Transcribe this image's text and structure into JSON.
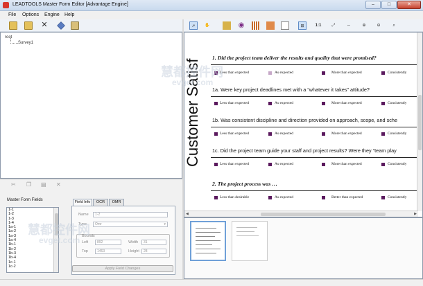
{
  "window": {
    "title": "LEADTOOLS Master Form Editor [Advantage Engine]",
    "min_glyph": "–",
    "max_glyph": "□",
    "close_glyph": "✕"
  },
  "menu": [
    "File",
    "Options",
    "Engine",
    "Help"
  ],
  "left_toolbar_icons": [
    "new-form-icon",
    "add-icon",
    "delete-icon",
    "edit-icon",
    "settings-icon"
  ],
  "tree": {
    "root": "root",
    "child": "Survey1"
  },
  "field_toolbar_icons": [
    "cut-icon",
    "copy-icon",
    "paste-icon",
    "delete-icon"
  ],
  "master_form_fields": {
    "label": "Master Form Fields",
    "items": [
      "1-1",
      "1-2",
      "1-3",
      "1-4",
      "1a-1",
      "1a-2",
      "1a-3",
      "1a-4",
      "1b-1",
      "1b-2",
      "1b-3",
      "1b-4",
      "1c-1",
      "1c-2"
    ]
  },
  "tabs": [
    "Field Info",
    "OCR",
    "OMR"
  ],
  "field_info": {
    "name_label": "Name",
    "name_value": "1-2",
    "type_label": "Type",
    "type_value": "Omr",
    "bounds_label": "Bounds",
    "left_label": "Left",
    "left_value": "892",
    "width_label": "Width",
    "width_value": "31",
    "top_label": "Top",
    "top_value": "1463",
    "height_label": "Height",
    "height_value": "28",
    "apply_label": "Apply Field Changes"
  },
  "right_toolbar_icons": [
    "select-pointer-icon",
    "pan-hand-icon",
    "text-field-icon",
    "omr-field-icon",
    "barcode-icon",
    "image-field-icon",
    "rectangle-icon",
    "region-icon",
    "one-to-one-label",
    "fit-page-icon",
    "fit-width-icon",
    "zoom-in-icon",
    "zoom-out-icon",
    "zoom-rect-icon"
  ],
  "zoom_1to1_label": "1:1",
  "document": {
    "side_title": "Customer Satisf",
    "questions": [
      {
        "text": "1.   Did the project team deliver the results and quality that were promised?",
        "bold": true,
        "options": [
          "Less than expected",
          "As expected",
          "More than expected",
          "Consistently"
        ],
        "selected": 1
      },
      {
        "text": "1a. Were key project deadlines met with a “whatever it takes” attitude?",
        "bold": false,
        "options": [
          "Less than expected",
          "As expected",
          "More than expected",
          "Consistently"
        ],
        "selected": -1
      },
      {
        "text": "1b. Was consistent discipline and direction provided on approach, scope, and sche",
        "bold": false,
        "options": [
          "Less than expected",
          "As expected",
          "More than expected",
          "Consistently"
        ],
        "selected": -1
      },
      {
        "text": "1c. Did the project team guide your staff and project results? Were they “team play",
        "bold": false,
        "options": [
          "Less than expected",
          "As expected",
          "More than expected",
          "Consistently"
        ],
        "selected": -1
      },
      {
        "text": "2.   The project process was …",
        "bold": true,
        "options": [
          "Less than desirable",
          "As expected",
          "Better than expected",
          "Consistently"
        ],
        "selected": -1
      }
    ]
  },
  "colors": {
    "accent": "#5e8bc7",
    "omr_mark": "#5b1a5e"
  },
  "watermark": {
    "cn1": "慧都控件网",
    "en1": "evget.com",
    "cn2": "慧都控件网",
    "en2": "evget.com"
  }
}
